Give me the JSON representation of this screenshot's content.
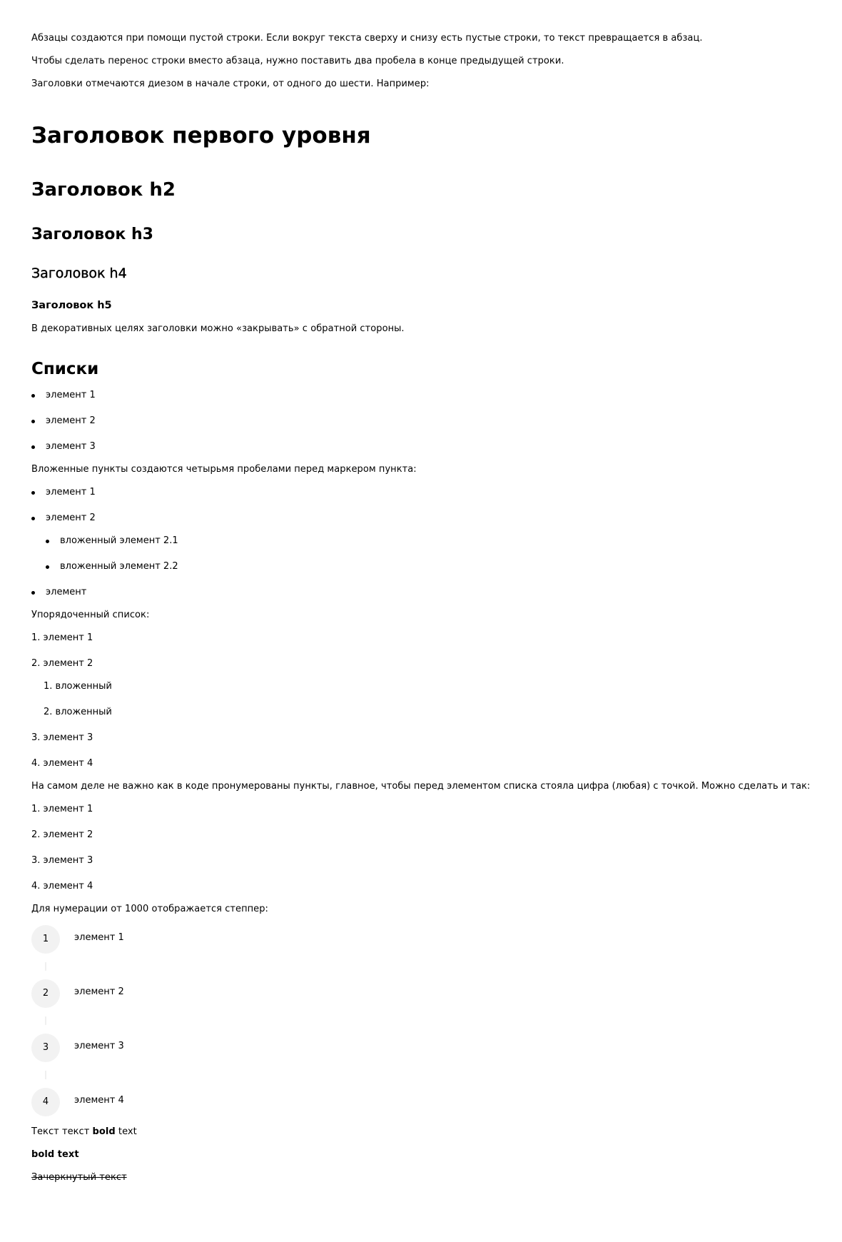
{
  "intro": {
    "p1": "Абзацы создаются при помощи пустой строки. Если вокруг текста сверху и снизу есть пустые строки, то текст превращается в абзац.",
    "p2": "Чтобы сделать перенос строки вместо абзаца, нужно поставить два пробела в конце предыдущей строки.",
    "p3": "Заголовки отмечаются диезом в начале строки, от одного до шести. Например:"
  },
  "headings": {
    "h1": "Заголовок первого уровня",
    "h2": "Заголовок h2",
    "h3": "Заголовок h3",
    "h4": "Заголовок h4",
    "h5": "Заголовок h5",
    "note": "В декоративных целях заголовки можно «закрывать» с обратной стороны."
  },
  "lists": {
    "title": "Списки",
    "unordered": [
      "элемент 1",
      "элемент 2",
      "элемент 3"
    ],
    "nested_intro": "Вложенные пункты создаются четырьмя пробелами перед маркером пункта:",
    "nested": {
      "top1": "элемент 1",
      "top2": "элемент 2",
      "sub": [
        "вложенный элемент 2.1",
        "вложенный элемент 2.2"
      ],
      "top3": "элемент"
    },
    "ordered_intro": "Упорядоченный список:",
    "ordered": {
      "i1": "1. элемент 1",
      "i2": "2. элемент 2",
      "sub": [
        "1. вложенный",
        "2. вложенный"
      ],
      "i3": "3. элемент 3",
      "i4": "4. элемент 4"
    },
    "numbering_note": "На самом деле не важно как в коде пронумерованы пункты, главное, чтобы перед элементом списка стояла цифра (любая) с точкой. Можно сделать и так:",
    "ordered2": [
      "1. элемент 1",
      "2. элемент 2",
      "3. элемент 3",
      "4. элемент 4"
    ],
    "stepper_intro": "Для нумерации от 1000 отображается степпер:",
    "stepper": [
      {
        "num": "1",
        "label": "элемент 1"
      },
      {
        "num": "2",
        "label": "элемент 2"
      },
      {
        "num": "3",
        "label": "элемент 3"
      },
      {
        "num": "4",
        "label": "элемент 4"
      }
    ]
  },
  "formatting": {
    "mixed_prefix": "Текст текст ",
    "mixed_bold": "bold",
    "mixed_suffix": " text",
    "bold_line": "bold text",
    "strike_line": "Зачеркнутый текст"
  }
}
